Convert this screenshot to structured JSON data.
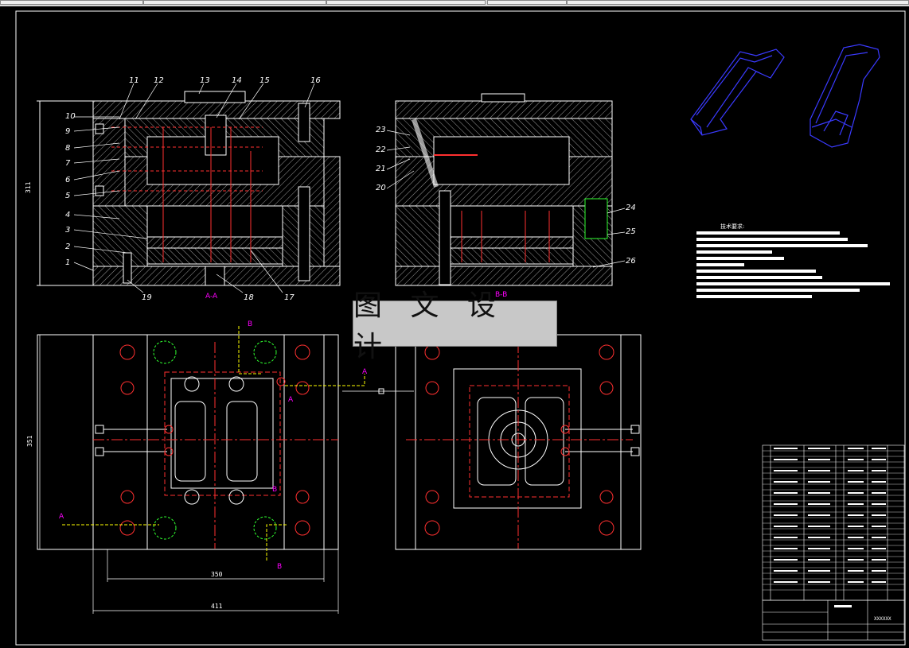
{
  "watermark": "图 文 设 计",
  "section_labels": {
    "aa": "A-A",
    "bb": "B-B"
  },
  "dimensions": {
    "height_top": "311",
    "height_bottom": "351",
    "width_inner": "350",
    "width_outer": "411"
  },
  "callouts_left": [
    "10",
    "9",
    "8",
    "7",
    "6",
    "5",
    "4",
    "3",
    "2",
    "1"
  ],
  "callouts_top": [
    "11",
    "12",
    "13",
    "14",
    "15",
    "16"
  ],
  "callouts_bottom": [
    "19",
    "18",
    "17"
  ],
  "callouts_b": [
    "23",
    "22",
    "21",
    "20"
  ],
  "callouts_b_right": [
    "24",
    "25",
    "26"
  ],
  "section_markers": {
    "a": "A",
    "b": "B"
  },
  "tech_title": "技术要求:",
  "title_block": {
    "code": "XXXXXX"
  },
  "colors": {
    "background": "#000000",
    "line": "#ffffff",
    "hatch": "#ffffff",
    "red": "#ff3030",
    "magenta": "#ff00ff",
    "yellow": "#ffff00",
    "blue": "#3a3aff",
    "cyan": "#00ffff",
    "green": "#30ff30"
  }
}
